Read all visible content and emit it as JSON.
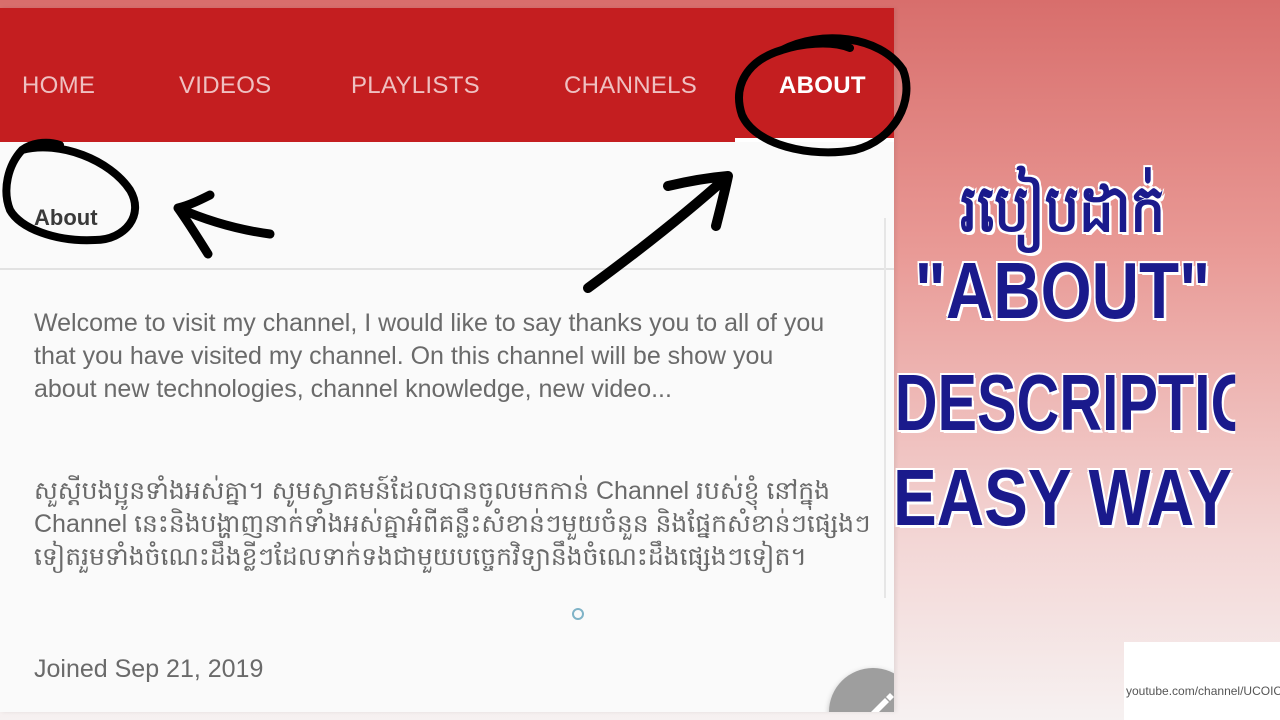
{
  "tabs": [
    {
      "label": "HOME",
      "active": false
    },
    {
      "label": "VIDEOS",
      "active": false
    },
    {
      "label": "PLAYLISTS",
      "active": false
    },
    {
      "label": "CHANNELS",
      "active": false
    },
    {
      "label": "ABOUT",
      "active": true
    }
  ],
  "about": {
    "header": "About",
    "description_en": "Welcome to visit my channel, I would like to say thanks you to all of you that you have visited my channel. On this channel will be show you about new technologies, channel knowledge, new video...",
    "description_km": "សួស្តីបងប្អូនទាំងអស់គ្នា។ សូមស្វាគមន៍ដែលបានចូលមកកាន់ Channel របស់ខ្ញុំ នៅក្នុង Channel នេះនិងបង្ហាញនាក់ទាំងអស់គ្នាអំពីគន្លឹះសំខាន់ៗមួយចំនួន និងផ្នែកសំខាន់ៗផ្សេងៗទៀតរួមទាំងចំណេះដឹងខ្លីៗដែលទាក់ទងជាមួយបច្ចេកវិទ្យានឹងចំណេះដឹងផ្សេងៗទៀត។",
    "joined": "Joined Sep 21, 2019"
  },
  "thumbnail_title": {
    "khmer": "របៀបដាក់",
    "line1": "\"ABOUT\"",
    "line2": "DESCRIPTIONS",
    "line3": "EASY WAY"
  },
  "url": {
    "text": "youtube.com/channel/UCOICI"
  },
  "icons": {
    "edit": "pencil-icon"
  },
  "colors": {
    "tab_bar": "#c41e20",
    "title_text": "#1a1a8c",
    "annotation": "#000000"
  }
}
